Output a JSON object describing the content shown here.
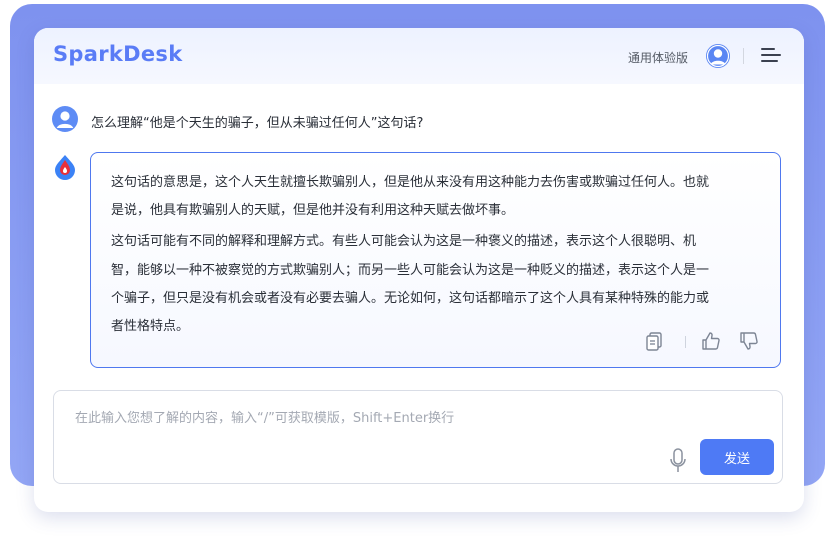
{
  "header": {
    "brand": "SparkDesk",
    "edition": "通用体验版",
    "avatar_icon": "user-avatar-icon",
    "menu_icon": "menu-icon"
  },
  "conversation": {
    "question": "怎么理解“他是个天生的骗子，但从未骗过任何人”这句话?",
    "answer_lines": [
      "这句话的意思是，这个人天生就擅长欺骗别人，但是他从来没有用这种能力去伤害或欺骗过任何人。也就",
      "是说，他具有欺骗别人的天赋，但是他并没有利用这种天赋去做坏事。",
      "这句话可能有不同的解释和理解方式。有些人可能会认为这是一种褒义的描述，表示这个人很聪明、机",
      "智，能够以一种不被察觉的方式欺骗别人；而另一些人可能会认为这是一种贬义的描述，表示这个人是一",
      "个骗子，但只是没有机会或者没有必要去骗人。无论如何，这句话都暗示了这个人具有某种特殊的能力或",
      "者性格特点。"
    ],
    "actions": [
      "copy-icon",
      "thumbs-up-icon",
      "thumbs-down-icon"
    ]
  },
  "input": {
    "placeholder": "在此输入您想了解的内容，输入“/”可获取模版，Shift+Enter换行",
    "send_label": "发送"
  },
  "colors": {
    "accent": "#4e7af5",
    "brand": "#5a7cf6",
    "frame": "#8a9df2"
  }
}
